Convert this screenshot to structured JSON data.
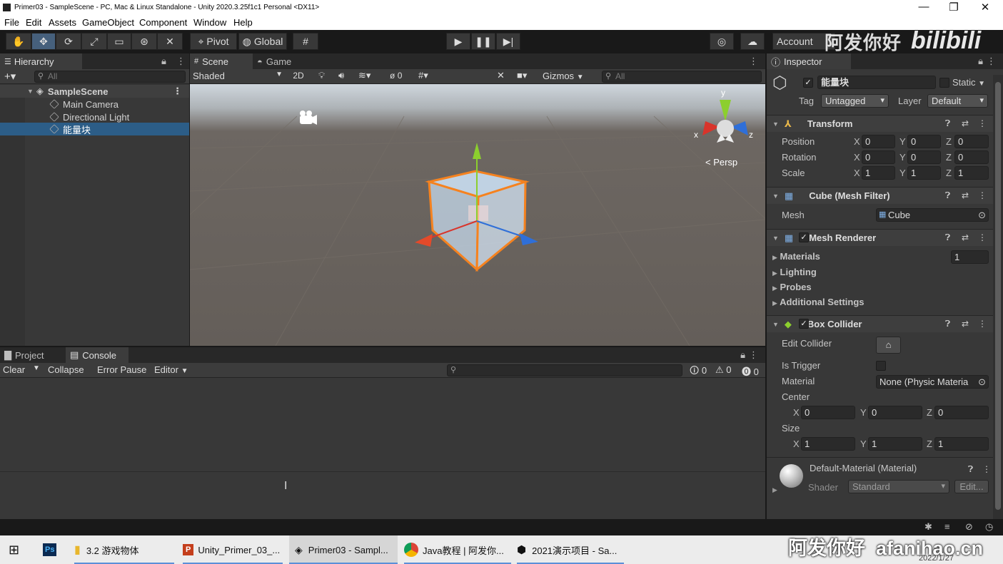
{
  "window": {
    "title": "Primer03 - SampleScene - PC, Mac & Linux Standalone - Unity 2020.3.25f1c1 Personal <DX11>",
    "controls": [
      "—",
      "❐",
      "✕"
    ]
  },
  "menu": [
    "File",
    "Edit",
    "Assets",
    "GameObject",
    "Component",
    "Window",
    "Help"
  ],
  "toolbar": {
    "pivot": "Pivot",
    "global": "Global",
    "account": "Account",
    "watermark_top": "阿发你好",
    "bilibili": "bilibili"
  },
  "hierarchy": {
    "tab": "Hierarchy",
    "search_placeholder": "All",
    "scene": "SampleScene",
    "items": [
      "Main Camera",
      "Directional Light",
      "能量块"
    ]
  },
  "scene": {
    "tabs": [
      "Scene",
      "Game"
    ],
    "shading": "Shaded",
    "mode_2d": "2D",
    "hidden_count": "0",
    "gizmos": "Gizmos",
    "search_placeholder": "All",
    "persp": "< Persp",
    "axis_y": "y",
    "axis_x": "x",
    "axis_z": "z"
  },
  "console": {
    "tabs": [
      "Project",
      "Console"
    ],
    "clear": "Clear",
    "collapse": "Collapse",
    "error_pause": "Error Pause",
    "editor": "Editor",
    "counts": {
      "log": "0",
      "warn": "0",
      "error": "0"
    }
  },
  "inspector": {
    "tab": "Inspector",
    "object_name": "能量块",
    "static": "Static",
    "tag_label": "Tag",
    "tag_value": "Untagged",
    "layer_label": "Layer",
    "layer_value": "Default",
    "transform": {
      "title": "Transform",
      "position_label": "Position",
      "rotation_label": "Rotation",
      "scale_label": "Scale",
      "position": {
        "x": "0",
        "y": "0",
        "z": "0"
      },
      "rotation": {
        "x": "0",
        "y": "0",
        "z": "0"
      },
      "scale": {
        "x": "1",
        "y": "1",
        "z": "1"
      }
    },
    "axis": {
      "x": "X",
      "y": "Y",
      "z": "Z"
    },
    "mesh_filter": {
      "title": "Cube (Mesh Filter)",
      "mesh_label": "Mesh",
      "mesh_value": "Cube"
    },
    "mesh_renderer": {
      "title": "Mesh Renderer",
      "materials": "Materials",
      "materials_count": "1",
      "lighting": "Lighting",
      "probes": "Probes",
      "additional": "Additional Settings"
    },
    "box_collider": {
      "title": "Box Collider",
      "edit_collider": "Edit Collider",
      "is_trigger": "Is Trigger",
      "material_label": "Material",
      "material_value": "None (Physic Materia",
      "center_label": "Center",
      "size_label": "Size",
      "center": {
        "x": "0",
        "y": "0",
        "z": "0"
      },
      "size": {
        "x": "1",
        "y": "1",
        "z": "1"
      }
    },
    "material": {
      "title": "Default-Material (Material)",
      "shader_label": "Shader",
      "shader_value": "Standard",
      "edit": "Edit..."
    }
  },
  "taskbar": {
    "items": [
      "3.2 游戏物体",
      "Unity_Primer_03_...",
      "Primer03 - Sampl...",
      "Java教程 | 阿发你...",
      "2021演示项目 - Sa..."
    ],
    "watermark": "阿发你好  afanihao.cn",
    "date": "2022/1/27"
  },
  "colors": {
    "selection": "#2c5d87",
    "cube_outline": "#f5821f",
    "x_axis": "#d9342b",
    "y_axis": "#8ccf2e",
    "z_axis": "#2f6fd8"
  }
}
